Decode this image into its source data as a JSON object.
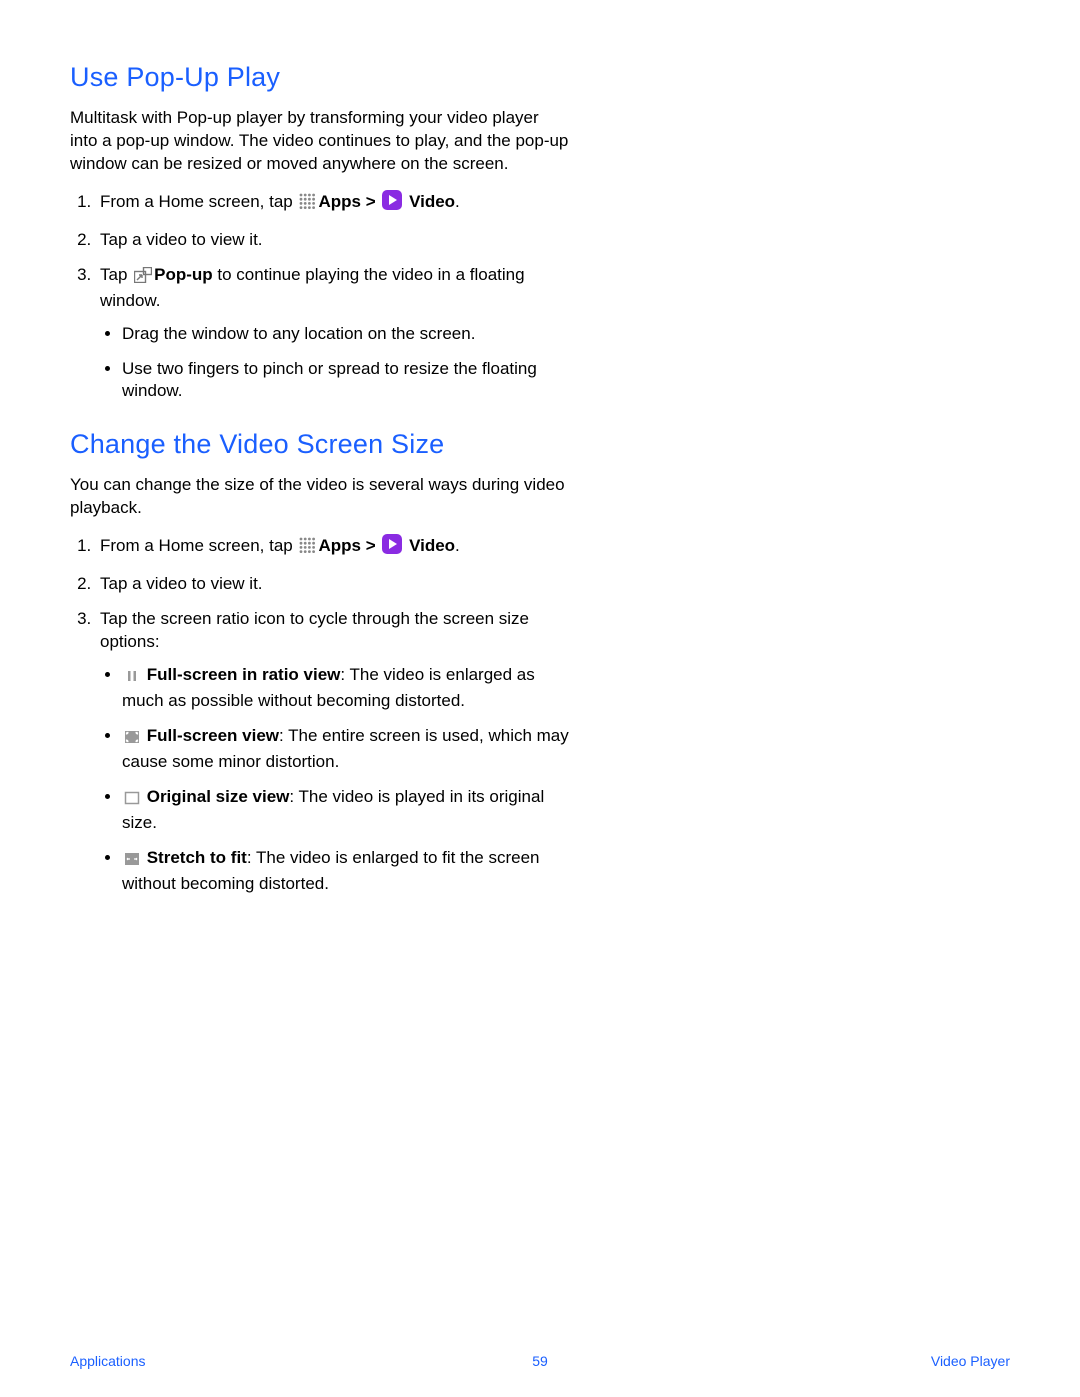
{
  "section1": {
    "title": "Use Pop-Up Play",
    "intro": "Multitask with Pop-up player by transforming your video player into a pop-up window. The video continues to play, and the pop-up window can be resized or moved anywhere on the screen.",
    "step1_prefix": "From a Home screen, tap ",
    "step1_apps_bold": "Apps > ",
    "step1_video_bold": " Video",
    "step1_suffix": ".",
    "step2": "Tap a video to view it.",
    "step3_prefix": "Tap ",
    "step3_popup_bold": "Pop-up",
    "step3_suffix": " to continue playing the video in a floating window.",
    "bullet1": "Drag the window to any location on the screen.",
    "bullet2": "Use two fingers to pinch or spread to resize the floating window."
  },
  "section2": {
    "title": "Change the Video Screen Size",
    "intro": "You can change the size of the video is several ways during video playback.",
    "step1_prefix": "From a Home screen, tap ",
    "step1_apps_bold": "Apps > ",
    "step1_video_bold": " Video",
    "step1_suffix": ".",
    "step2": "Tap a video to view it.",
    "step3": "Tap the screen ratio icon to cycle through the screen size options:",
    "b1_bold": " Full-screen in ratio view",
    "b1_rest": ": The video is enlarged as much as possible without becoming distorted.",
    "b2_bold": " Full-screen view",
    "b2_rest": ": The entire screen is used, which may cause some minor distortion.",
    "b3_bold": " Original size view",
    "b3_rest": ": The video is played in its original size.",
    "b4_bold": " Stretch to fit",
    "b4_rest": ": The video is enlarged to fit the screen without becoming distorted."
  },
  "footer": {
    "left": "Applications",
    "page": "59",
    "right": "Video Player"
  }
}
